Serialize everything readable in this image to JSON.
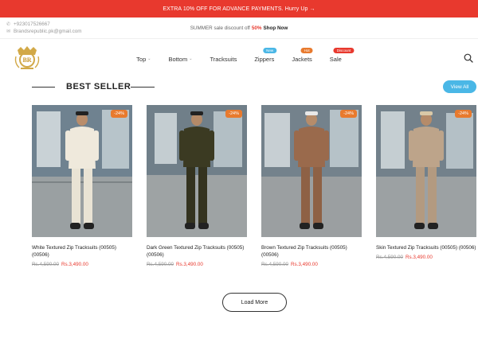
{
  "colors": {
    "accent": "#e8392e",
    "view_all": "#4ab7e6",
    "badge_blue": "#4ab7e6",
    "badge_orange": "#e87a2e",
    "badge_red": "#e8392e"
  },
  "promo": {
    "text": "EXTRA 10% OFF FOR ADVANCE PAYMENTS. Hurry Up →"
  },
  "contact": {
    "phone": "+923017526667",
    "email": "Brandsrepublic.pk@gmail.com",
    "phone_icon": "phone-icon",
    "email_icon": "mail-icon"
  },
  "summer": {
    "text": "SUMMER sale discount off",
    "pct": "50%",
    "shop": "Shop Now"
  },
  "nav": {
    "items": [
      {
        "label": "Top",
        "dropdown": true
      },
      {
        "label": "Bottom",
        "dropdown": true
      },
      {
        "label": "Tracksuits",
        "dropdown": false
      },
      {
        "label": "Zippers",
        "dropdown": false,
        "badge": "New"
      },
      {
        "label": "Jackets",
        "dropdown": false,
        "badge": "Hot"
      },
      {
        "label": "Sale",
        "dropdown": false,
        "badge": "Discount"
      }
    ]
  },
  "section": {
    "title": "BEST SELLER",
    "view_all": "View All"
  },
  "products": [
    {
      "name": "White Textured Zip Tracksuits (00505) (00506)",
      "old_price": "Rs.4,590.00",
      "new_price": "Rs.3,490.00",
      "discount": "-24%"
    },
    {
      "name": "Dark Green Textured Zip Tracksuits (00505) (00506)",
      "old_price": "Rs.4,590.00",
      "new_price": "Rs.3,490.00",
      "discount": "-24%"
    },
    {
      "name": "Brown Textured Zip Tracksuits (00505) (00506)",
      "old_price": "Rs.4,590.00",
      "new_price": "Rs.3,490.00",
      "discount": "-24%"
    },
    {
      "name": "Skin Textured Zip Tracksuits (00505) (00506)",
      "old_price": "Rs.4,590.00",
      "new_price": "Rs.3,490.00",
      "discount": "-24%"
    }
  ],
  "load_more": "Load More"
}
